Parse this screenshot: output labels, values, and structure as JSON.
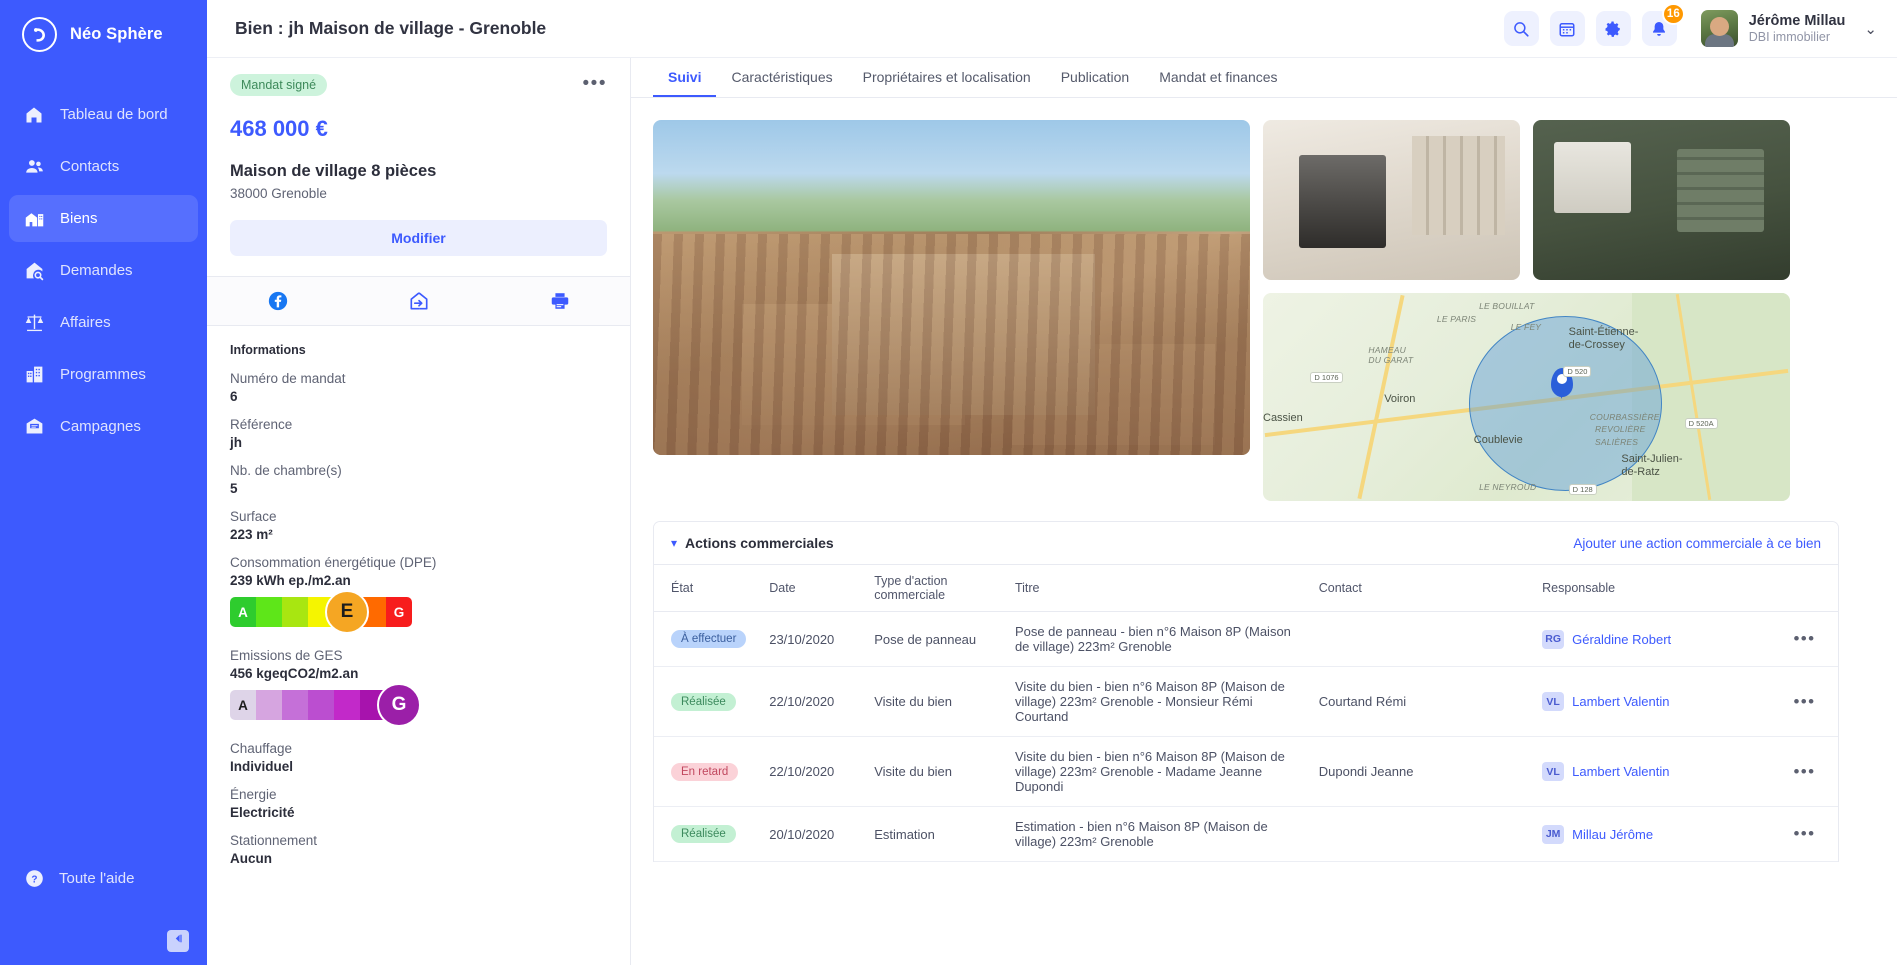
{
  "brand": {
    "name": "Néo Sphère"
  },
  "sidebar": {
    "items": [
      {
        "label": "Tableau de bord",
        "icon": "home-icon",
        "active": false
      },
      {
        "label": "Contacts",
        "icon": "contacts-icon",
        "active": false
      },
      {
        "label": "Biens",
        "icon": "building-icon",
        "active": true
      },
      {
        "label": "Demandes",
        "icon": "house-search-icon",
        "active": false
      },
      {
        "label": "Affaires",
        "icon": "scales-icon",
        "active": false
      },
      {
        "label": "Programmes",
        "icon": "city-icon",
        "active": false
      },
      {
        "label": "Campagnes",
        "icon": "mail-icon",
        "active": false
      }
    ],
    "help": {
      "label": "Toute l'aide",
      "icon": "question-circle-icon"
    },
    "collapse": {
      "icon": "collapse-arrow-icon"
    }
  },
  "topbar": {
    "title": "Bien : jh Maison de village - Grenoble",
    "icons": [
      {
        "name": "search-icon"
      },
      {
        "name": "calendar-icon"
      },
      {
        "name": "gear-icon"
      },
      {
        "name": "bell-icon",
        "badge": "16"
      }
    ],
    "user": {
      "name": "Jérôme Millau",
      "org": "DBI immobilier",
      "caret": "chevron-down-icon"
    }
  },
  "property": {
    "status": "Mandat signé",
    "price": "468 000 €",
    "title": "Maison de village 8 pièces",
    "address": "38000 Grenoble",
    "modify_label": "Modifier",
    "share": [
      {
        "name": "facebook-icon"
      },
      {
        "name": "portal-export-icon"
      },
      {
        "name": "print-icon"
      }
    ],
    "info_header": "Informations",
    "info": [
      {
        "label": "Numéro de mandat",
        "value": "6"
      },
      {
        "label": "Référence",
        "value": "jh"
      },
      {
        "label": "Nb. de chambre(s)",
        "value": "5"
      },
      {
        "label": "Surface",
        "value": "223 m²"
      }
    ],
    "dpe": {
      "label": "Consommation énergétique (DPE)",
      "value": "239 kWh ep./m2.an",
      "grade": "E",
      "first": "A",
      "last": "G",
      "badge_color": "#f5a623",
      "colors": [
        "#2ecc2e",
        "#5ee619",
        "#a8e611",
        "#f5f500",
        "#ffd000",
        "#ff6a00",
        "#f71d1d"
      ]
    },
    "ges": {
      "label": "Emissions de GES",
      "value": "456 kgeqCO2/m2.an",
      "grade": "G",
      "first": "A",
      "last": "G",
      "badge_color": "#9b1fa8",
      "colors": [
        "#ded4e8",
        "#d6a5e0",
        "#c570d8",
        "#bb4ed0",
        "#c229c9",
        "#a713ad",
        "#8c0f94"
      ]
    },
    "info2": [
      {
        "label": "Chauffage",
        "value": "Individuel"
      },
      {
        "label": "Énergie",
        "value": "Electricité"
      },
      {
        "label": "Stationnement",
        "value": "Aucun"
      }
    ]
  },
  "tabs": [
    {
      "label": "Suivi",
      "active": true
    },
    {
      "label": "Caractéristiques",
      "active": false
    },
    {
      "label": "Propriétaires et localisation",
      "active": false
    },
    {
      "label": "Publication",
      "active": false
    },
    {
      "label": "Mandat et finances",
      "active": false
    }
  ],
  "media": {
    "hero": "property-hero-photo",
    "thumbs": [
      "living-room-photo",
      "kitchen-photo"
    ],
    "map": {
      "name": "location-map",
      "towns": [
        "Voiron",
        "Coublevie",
        "Saint-Étienne-de-Crossey",
        "Saint-Julien-de-Ratz",
        "Cassien"
      ],
      "hamlets": [
        "LE BOUILLAT",
        "LE PARIS",
        "LE FEY",
        "HAMEAU DU GARAT",
        "COURBASSIÈRE",
        "REVOLIÈRE",
        "SALIÈRES",
        "LE NEYROUD"
      ],
      "roads": [
        "D 1076",
        "D 520",
        "D 520A",
        "D 128"
      ]
    }
  },
  "actions": {
    "title": "Actions commerciales",
    "add_link": "Ajouter une action commerciale à ce bien",
    "columns": [
      "État",
      "Date",
      "Type d'action commerciale",
      "Titre",
      "Contact",
      "Responsable",
      ""
    ],
    "rows": [
      {
        "etat": "À effectuer",
        "etat_style": "todo",
        "date": "23/10/2020",
        "type": "Pose de panneau",
        "titre": "Pose de panneau - bien n°6 Maison 8P (Maison de village) 223m² Grenoble",
        "contact": "",
        "resp_initials": "RG",
        "resp": "Géraldine Robert",
        "menu": "•••"
      },
      {
        "etat": "Réalisée",
        "etat_style": "done",
        "date": "22/10/2020",
        "type": "Visite du bien",
        "titre": "Visite du bien - bien n°6 Maison 8P (Maison de village) 223m² Grenoble - Monsieur Rémi Courtand",
        "contact": "Courtand Rémi",
        "resp_initials": "VL",
        "resp": "Lambert Valentin",
        "menu": "•••"
      },
      {
        "etat": "En retard",
        "etat_style": "late",
        "date": "22/10/2020",
        "type": "Visite du bien",
        "titre": "Visite du bien - bien n°6 Maison 8P (Maison de village) 223m² Grenoble - Madame Jeanne Dupondi",
        "contact": "Dupondi Jeanne",
        "resp_initials": "VL",
        "resp": "Lambert Valentin",
        "menu": "•••"
      },
      {
        "etat": "Réalisée",
        "etat_style": "done",
        "date": "20/10/2020",
        "type": "Estimation",
        "titre": "Estimation - bien n°6 Maison 8P (Maison de village) 223m² Grenoble",
        "contact": "",
        "resp_initials": "JM",
        "resp": "Millau Jérôme",
        "menu": "•••"
      }
    ]
  },
  "colors": {
    "brand": "#3d5afe",
    "accent_orange": "#ff9800",
    "sidebar": "#3d5afe"
  }
}
